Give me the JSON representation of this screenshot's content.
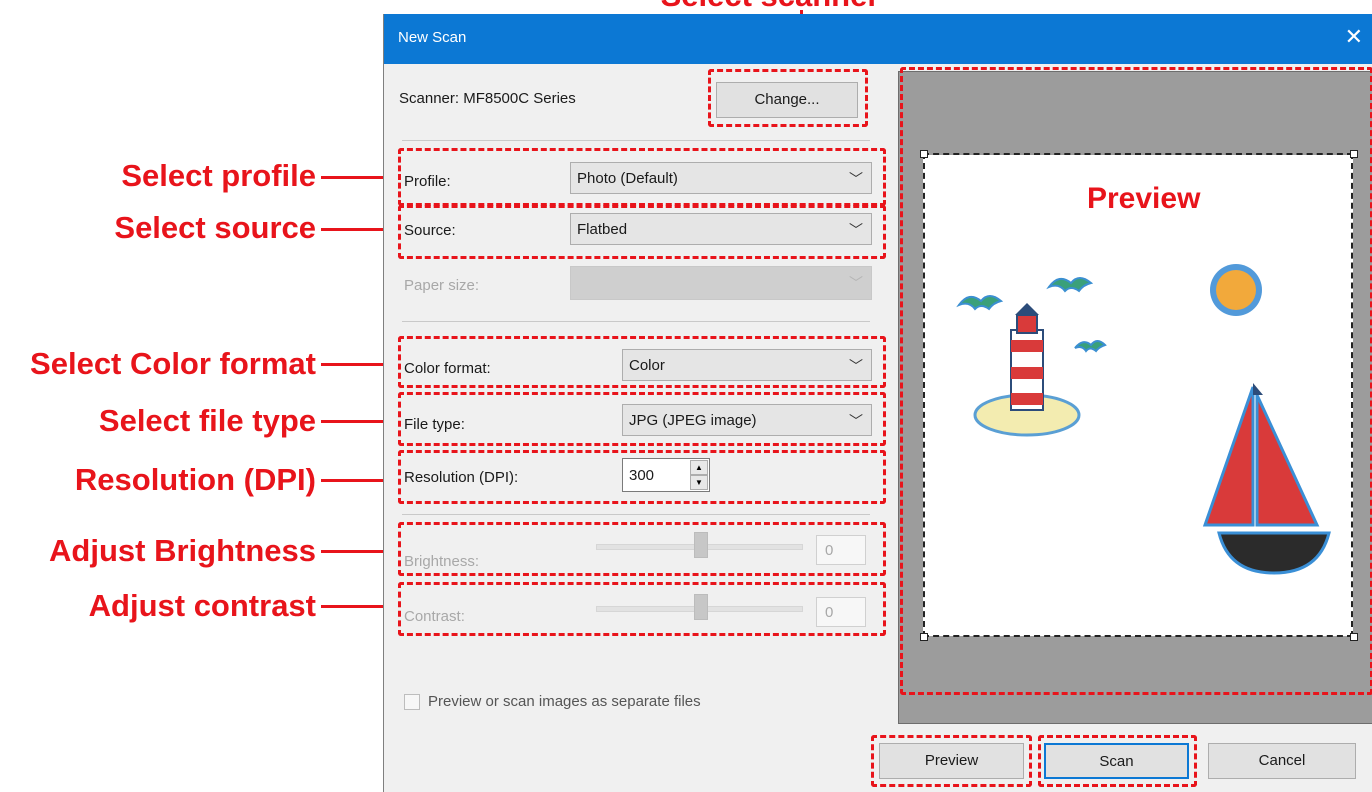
{
  "dialog": {
    "title": "New Scan",
    "close_glyph": "✕",
    "scanner_label": "Scanner: MF8500C Series",
    "change_button": "Change...",
    "profile_label": "Profile:",
    "profile_value": "Photo (Default)",
    "source_label": "Source:",
    "source_value": "Flatbed",
    "paper_size_label": "Paper size:",
    "paper_size_value": "",
    "color_format_label": "Color format:",
    "color_format_value": "Color",
    "file_type_label": "File type:",
    "file_type_value": "JPG (JPEG image)",
    "resolution_label": "Resolution (DPI):",
    "resolution_value": "300",
    "brightness_label": "Brightness:",
    "brightness_value": "0",
    "contrast_label": "Contrast:",
    "contrast_value": "0",
    "separate_files_label": "Preview or scan images as separate files",
    "separate_files_checked": false,
    "preview_button": "Preview",
    "scan_button": "Scan",
    "cancel_button": "Cancel"
  },
  "annotations": {
    "select_scanner": "Select scanner",
    "select_profile": "Select profile",
    "select_source": "Select source",
    "select_color_format": "Select Color format",
    "select_file_type": "Select file type",
    "resolution": "Resolution (DPI)",
    "adjust_brightness": "Adjust Brightness",
    "adjust_contrast": "Adjust contrast",
    "preview": "Preview"
  },
  "colors": {
    "annotation": "#e8141b",
    "titlebar": "#0c78d4",
    "dialog_bg": "#f0f0f0",
    "preview_bg": "#9c9c9c"
  },
  "icons": [
    "close-icon",
    "dropdown-arrow-icon",
    "spin-up-icon",
    "spin-down-icon"
  ]
}
